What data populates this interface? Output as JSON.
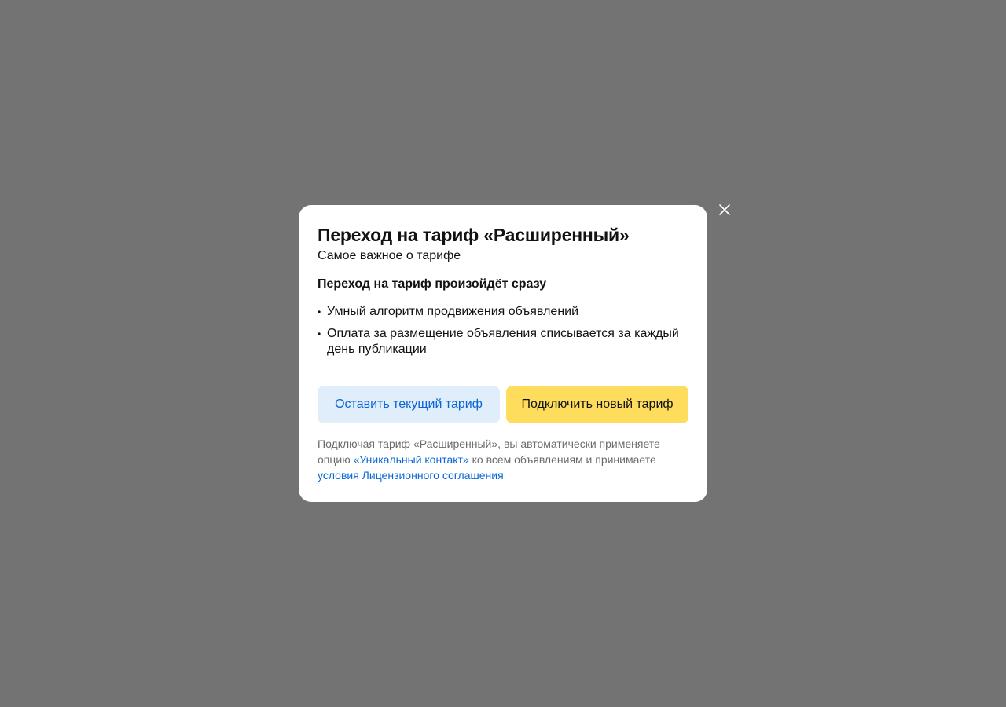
{
  "modal": {
    "title": "Переход на тариф «Расширенный»",
    "subtitle": "Самое важное о тарифе",
    "heading": "Переход на тариф произойдёт сразу",
    "bullets": [
      "Умный алгоритм продвижения объявлений",
      "Оплата за размещение объявления списывается за каждый день публикации"
    ],
    "keep_button": "Оставить текущий тариф",
    "connect_button": "Подключить новый тариф",
    "footer": {
      "text1": "Подключая тариф «Расширенный», вы автоматически применяете опцию ",
      "link1": "«Уникальный контакт»",
      "text2": " ко всем объявлениям и принимаете ",
      "link2": "условия Лицензионного соглашения"
    },
    "close_icon": "close-icon"
  },
  "colors": {
    "overlay": "#737373",
    "primary": "#ffdd5c",
    "secondary_bg": "#e0edfb",
    "link": "#0a66d6"
  }
}
